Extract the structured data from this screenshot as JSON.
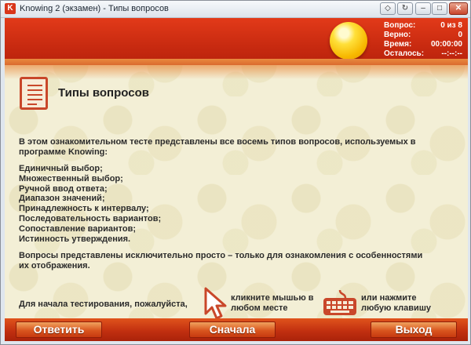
{
  "window": {
    "title": "Knowing 2 (экзамен) - Типы вопросов",
    "controls": [
      "◇",
      "↻",
      "–",
      "□",
      "✕"
    ]
  },
  "stats": [
    {
      "label": "Вопрос:",
      "value": "0 из 8"
    },
    {
      "label": "Верно:",
      "value": "0"
    },
    {
      "label": "Время:",
      "value": "00:00:00"
    },
    {
      "label": "Осталось:",
      "value": "--:--:--"
    }
  ],
  "page": {
    "title": "Типы вопросов",
    "intro": "В этом ознакомительном тесте представлены все восемь типов вопросов, используемых в программе Knowing:",
    "types": [
      "Единичный выбор;",
      "Множественный выбор;",
      "Ручной ввод ответа;",
      "Диапазон значений;",
      "Принадлежность к интервалу;",
      "Последовательность вариантов;",
      "Сопоставление вариантов;",
      "Истинность утверждения."
    ],
    "note": "Вопросы представлены исключительно просто – только для ознакомления с особенностями их отображения.",
    "start_prompt": "Для начала тестирования, пожалуйста,",
    "click_hint": "кликните мышью в любом месте",
    "key_hint": "или нажмите любую клавишу"
  },
  "footer": {
    "answer": "Ответить",
    "restart": "Сначала",
    "exit": "Выход"
  },
  "colors": {
    "header_red": "#d0300f",
    "accent_orange": "#e06a2a",
    "background": "#f3efd6"
  }
}
